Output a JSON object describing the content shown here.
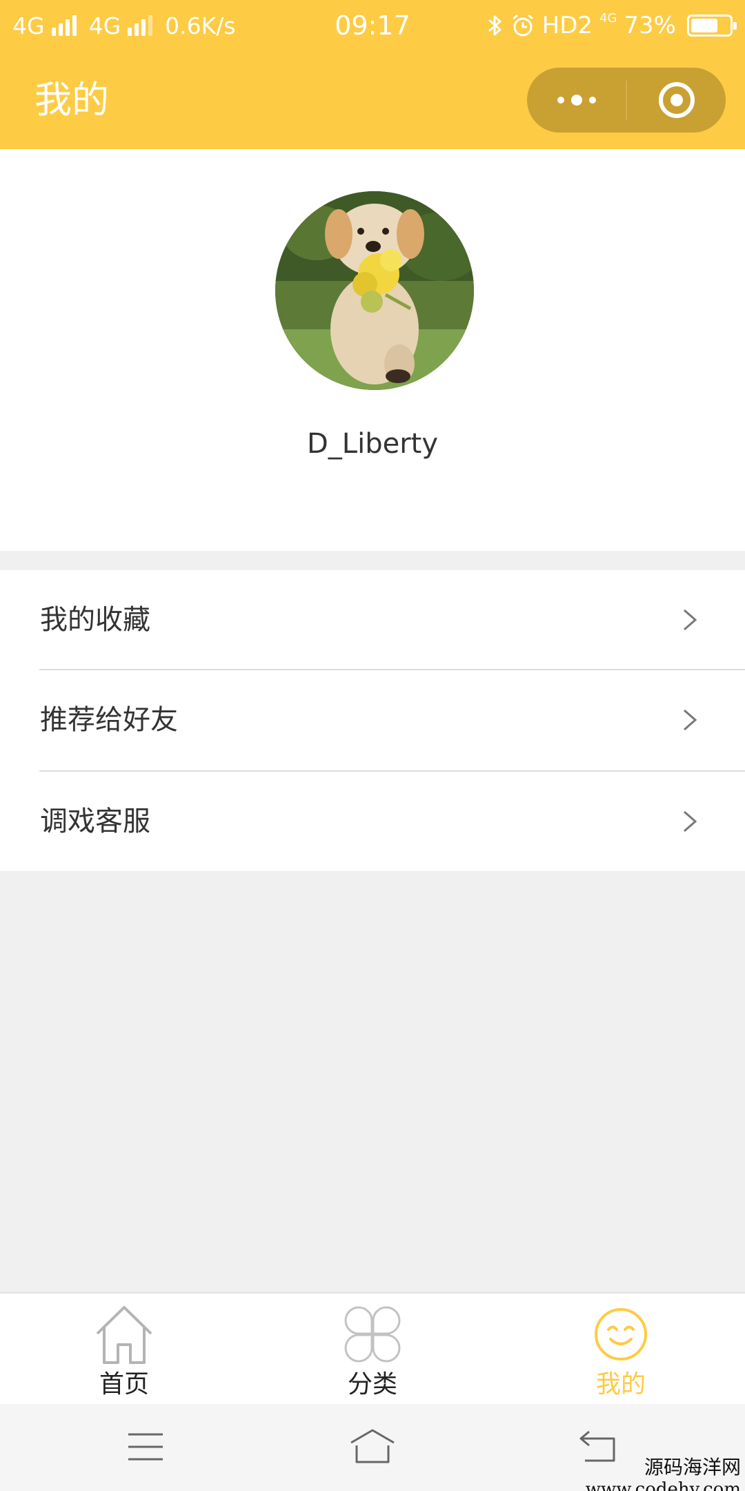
{
  "status_bar": {
    "net1": "4G",
    "net2": "4G",
    "speed": "0.6K/s",
    "time": "09:17",
    "hd": "HD2",
    "net3": "4G",
    "battery": "73%",
    "battery_level": 0.73,
    "icons": [
      "signal-icon",
      "bluetooth-icon",
      "alarm-icon",
      "battery-icon"
    ]
  },
  "nav": {
    "title": "我的",
    "more_icon": "more-dots-icon",
    "close_icon": "target-circle-icon",
    "bg_color": "#fdcb44"
  },
  "profile": {
    "avatar_icon": "dog-avatar",
    "username": "D_Liberty"
  },
  "menu": {
    "items": [
      {
        "label": "我的收藏",
        "icon": "chevron-right-icon"
      },
      {
        "label": "推荐给好友",
        "icon": "chevron-right-icon"
      },
      {
        "label": "调戏客服",
        "icon": "chevron-right-icon"
      }
    ]
  },
  "tabbar": {
    "tabs": [
      {
        "label": "首页",
        "icon": "home-icon",
        "active": false
      },
      {
        "label": "分类",
        "icon": "clover-icon",
        "active": false
      },
      {
        "label": "我的",
        "icon": "smile-icon",
        "active": true
      }
    ],
    "active_color": "#fdcb44"
  },
  "system_nav": {
    "icons": [
      "menu-lines-icon",
      "home-outline-icon",
      "back-icon"
    ]
  },
  "watermark": {
    "line1": "源码海洋网",
    "line2": "www.codehy.com"
  }
}
